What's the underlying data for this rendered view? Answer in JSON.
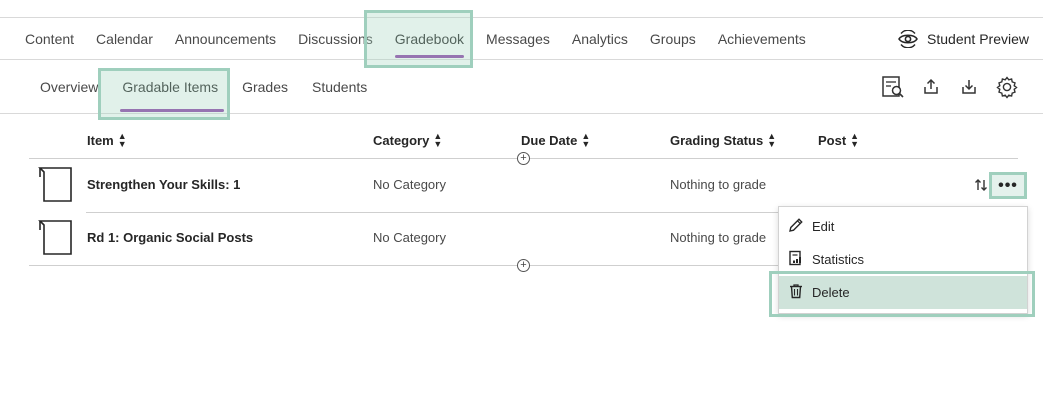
{
  "top_nav": {
    "tabs": [
      {
        "label": "Content"
      },
      {
        "label": "Calendar"
      },
      {
        "label": "Announcements"
      },
      {
        "label": "Discussions"
      },
      {
        "label": "Gradebook",
        "active": true
      },
      {
        "label": "Messages"
      },
      {
        "label": "Analytics"
      },
      {
        "label": "Groups"
      },
      {
        "label": "Achievements"
      }
    ],
    "student_preview": "Student Preview"
  },
  "sub_nav": {
    "tabs": [
      {
        "label": "Overview"
      },
      {
        "label": "Gradable Items",
        "active": true
      },
      {
        "label": "Grades"
      },
      {
        "label": "Students"
      }
    ],
    "tools": [
      "grade-search-icon",
      "upload-icon",
      "download-icon",
      "settings-icon"
    ]
  },
  "table": {
    "headers": {
      "item": "Item",
      "category": "Category",
      "due_date": "Due Date",
      "grading_status": "Grading Status",
      "post": "Post"
    },
    "rows": [
      {
        "name": "Strengthen Your Skills: 1",
        "category": "No Category",
        "due_date": "",
        "status": "Nothing to grade"
      },
      {
        "name": "Rd 1: Organic Social Posts",
        "category": "No Category",
        "due_date": "",
        "status": "Nothing to grade"
      }
    ]
  },
  "context_menu": {
    "items": [
      {
        "label": "Edit",
        "icon": "pencil-icon"
      },
      {
        "label": "Statistics",
        "icon": "statistics-icon"
      },
      {
        "label": "Delete",
        "icon": "trash-icon",
        "highlighted": true
      }
    ]
  },
  "colors": {
    "accent": "#8c3fa8",
    "highlight": "#9fcfbd",
    "menu_highlight": "#cfe3da"
  }
}
